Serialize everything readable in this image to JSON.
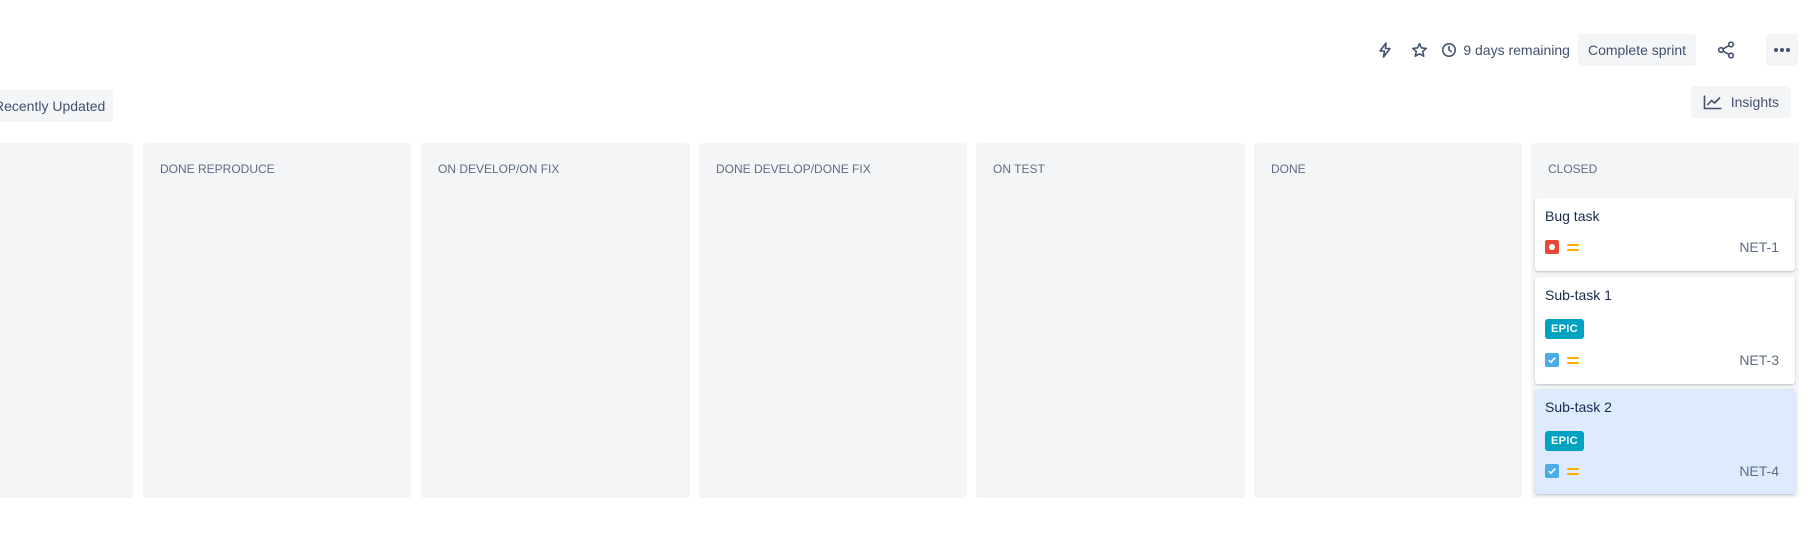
{
  "toolbar": {
    "remaining_label": "9 days remaining",
    "complete_sprint_label": "Complete sprint"
  },
  "filters": {
    "recently_updated_label": "Recently Updated",
    "insights_label": "Insights"
  },
  "columns": [
    {
      "title": ""
    },
    {
      "title": "DONE REPRODUCE"
    },
    {
      "title": "ON DEVELOP/ON FIX"
    },
    {
      "title": "DONE DEVELOP/DONE FIX"
    },
    {
      "title": "ON TEST"
    },
    {
      "title": "DONE"
    },
    {
      "title": "CLOSED"
    }
  ],
  "cards": [
    {
      "title": "Bug task",
      "type": "bug-icon",
      "priority": "medium-priority-icon",
      "epic": "",
      "key": "NET-1"
    },
    {
      "title": "Sub-task 1",
      "type": "subtask-icon",
      "priority": "medium-priority-icon",
      "epic": "EPIC",
      "key": "NET-3"
    },
    {
      "title": "Sub-task 2",
      "type": "subtask-icon",
      "priority": "medium-priority-icon",
      "epic": "EPIC",
      "key": "NET-4",
      "selected": true
    }
  ],
  "colors": {
    "column_bg": "#f4f5f7",
    "epic_badge": "#00a3bf",
    "bug": "#e5493a",
    "subtask": "#4bade8",
    "priority_medium": "#ffab00",
    "selected_card": "#deebff"
  }
}
